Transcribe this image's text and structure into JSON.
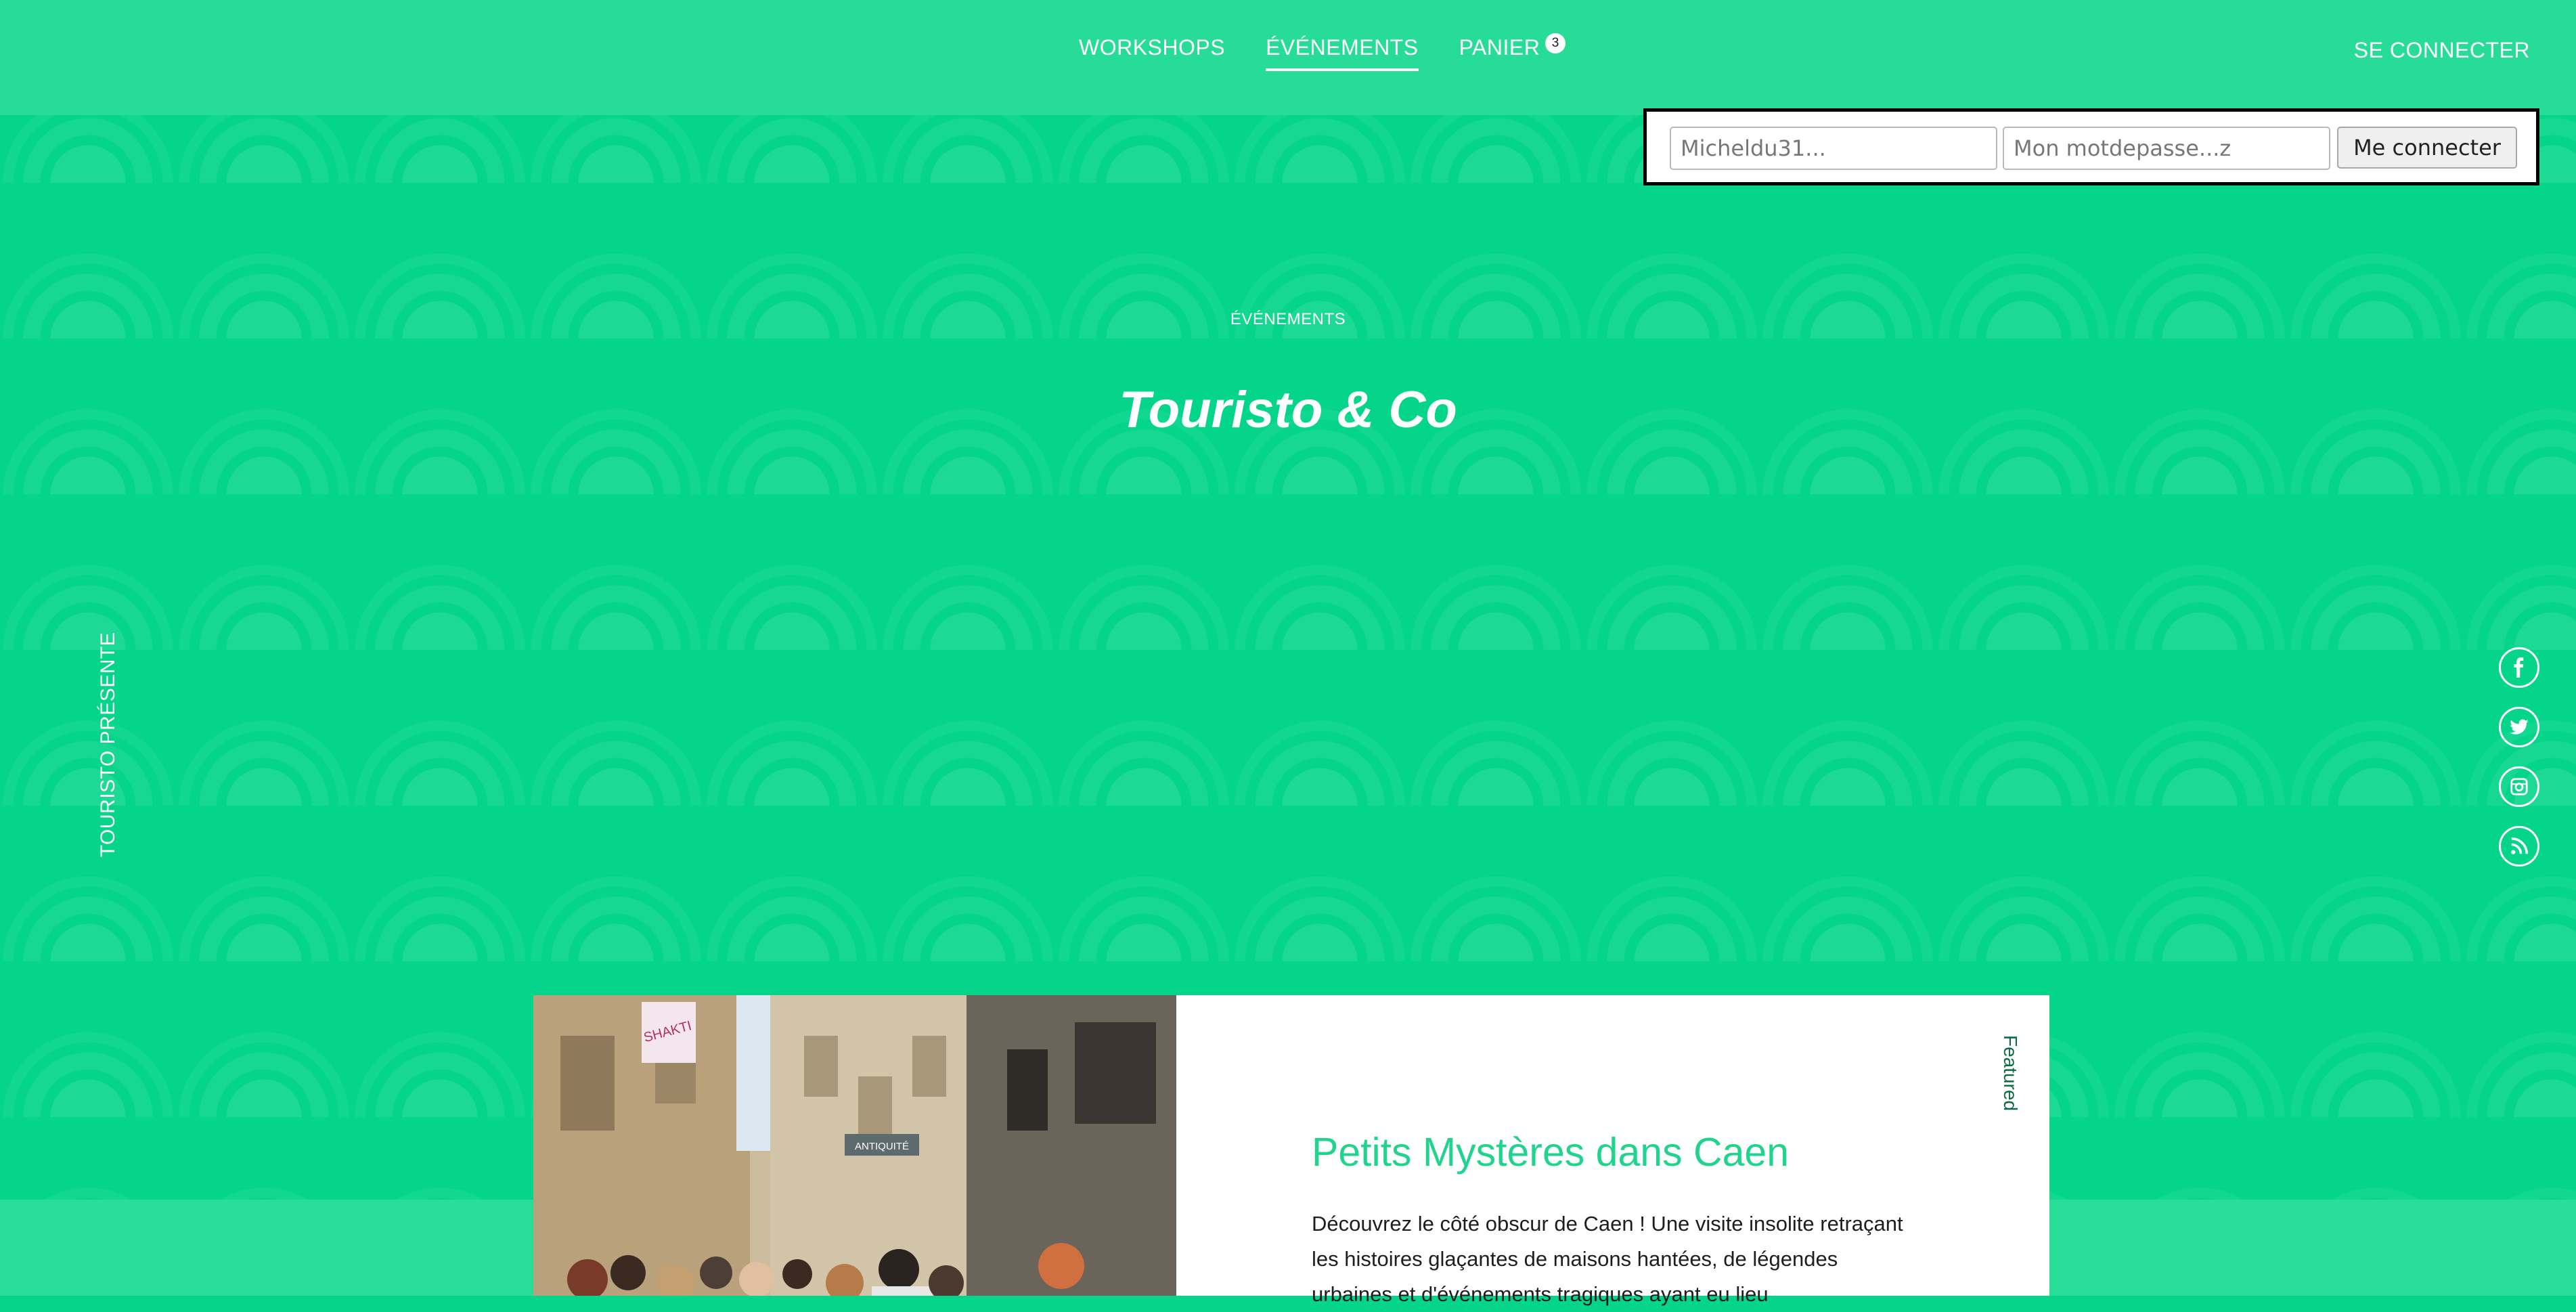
{
  "nav": {
    "links": [
      {
        "label": "WORKSHOPS",
        "active": false
      },
      {
        "label": "ÉVÉNEMENTS",
        "active": true
      },
      {
        "label": "PANIER",
        "active": false
      }
    ],
    "cart_count": "3",
    "login_link": "SE CONNECTER"
  },
  "login": {
    "username_placeholder": "Micheldu31...",
    "password_placeholder": "Mon motdepasse...z",
    "submit_label": "Me connecter"
  },
  "hero": {
    "kicker": "ÉVÉNEMENTS",
    "title": "Touristo & Co"
  },
  "side": {
    "vertical_text": "TOURISTO PRÉSENTE"
  },
  "socials": [
    "facebook-icon",
    "twitter-icon",
    "instagram-icon",
    "rss-icon"
  ],
  "card": {
    "featured": "Featured",
    "title": "Petits Mystères dans Caen",
    "text": "Découvrez le côté obscur de Caen ! Une visite insolite retraçant les histoires glaçantes de maisons hantées, de légendes urbaines et d'événements tragiques ayant eu lieu",
    "shop_signs": [
      "SHAKTI",
      "ANTIQUITÉ"
    ]
  },
  "colors": {
    "accent": "#05d58a",
    "nav_bg": "#27dc97",
    "title_green": "#21d48e"
  }
}
